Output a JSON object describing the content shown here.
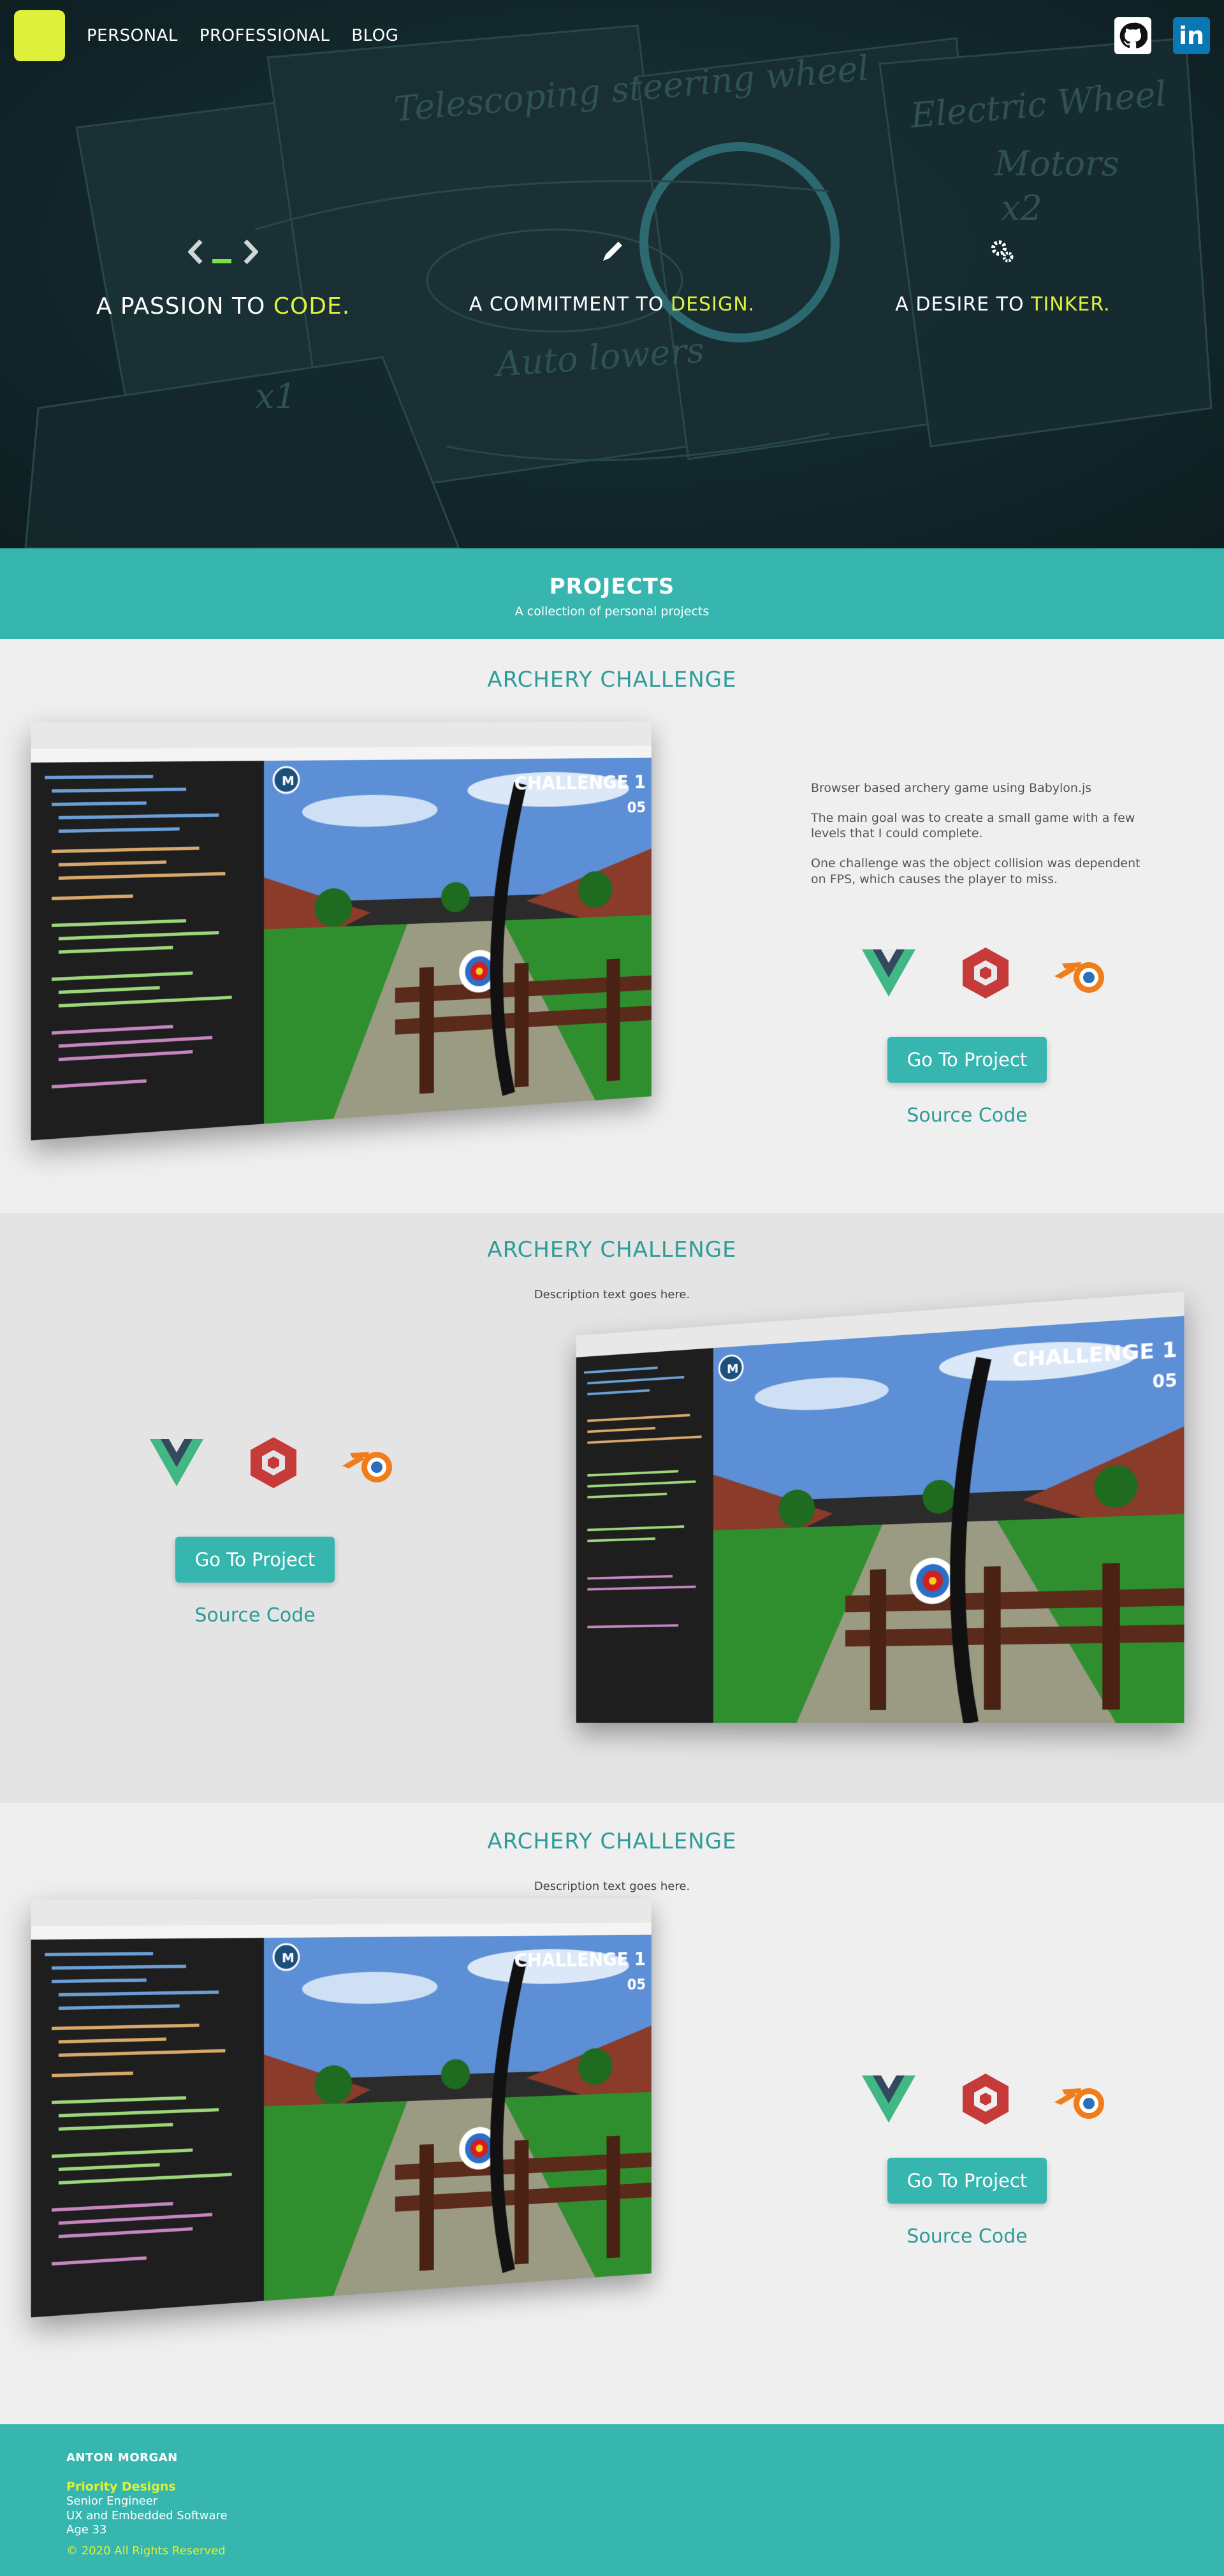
{
  "nav": {
    "links": [
      "PERSONAL",
      "PROFESSIONAL",
      "BLOG"
    ],
    "social": [
      "github-icon",
      "linkedin-icon"
    ]
  },
  "hero": {
    "pillars": [
      {
        "prefix": "A PASSION TO ",
        "highlight": "CODE.",
        "icon": "code-brackets-icon"
      },
      {
        "prefix": "A COMMITMENT TO ",
        "highlight": "DESIGN.",
        "icon": "pencil-icon"
      },
      {
        "prefix": "A DESIRE TO ",
        "highlight": "TINKER.",
        "icon": "gears-icon"
      }
    ],
    "sketch_text": [
      "Telescoping steering wheel",
      "Electric Wheel",
      "Motors",
      "x2",
      "Auto lowers",
      "x1"
    ]
  },
  "projects_header": {
    "title": "PROJECTS",
    "subtitle": "A collection of personal projects"
  },
  "projects": [
    {
      "title": "ARCHERY CHALLENGE",
      "description": [
        "Browser based archery game using Babylon.js",
        "The main goal was to create a small game with a few levels that I could complete.",
        "One challenge was the object collision was dependent on FPS, which causes the player to miss."
      ],
      "tech": [
        "vue-icon",
        "babylonjs-icon",
        "blender-icon"
      ],
      "cta": "Go To Project",
      "source": "Source Code",
      "game_hud": {
        "challenge": "CHALLENGE 1",
        "arrows": "05",
        "badge": "M"
      }
    },
    {
      "title": "ARCHERY CHALLENGE",
      "description": "Description text goes here.",
      "tech": [
        "vue-icon",
        "babylonjs-icon",
        "blender-icon"
      ],
      "cta": "Go To Project",
      "source": "Source Code",
      "game_hud": {
        "challenge": "CHALLENGE 1",
        "arrows": "05",
        "badge": "M"
      }
    },
    {
      "title": "ARCHERY CHALLENGE",
      "description": "Description text goes here.",
      "tech": [
        "vue-icon",
        "babylonjs-icon",
        "blender-icon"
      ],
      "cta": "Go To Project",
      "source": "Source Code",
      "game_hud": {
        "challenge": "CHALLENGE 1",
        "arrows": "05",
        "badge": "M"
      }
    }
  ],
  "footer": {
    "name": "ANTON MORGAN",
    "company": "Priority Designs",
    "role": "Senior Engineer",
    "focus": "UX and Embedded Software",
    "age": "Age 33",
    "copyright": "© 2020 All Rights Reserved"
  },
  "colors": {
    "accent": "#37b6b0",
    "highlight": "#dff03a",
    "title_teal": "#2e9c98"
  }
}
